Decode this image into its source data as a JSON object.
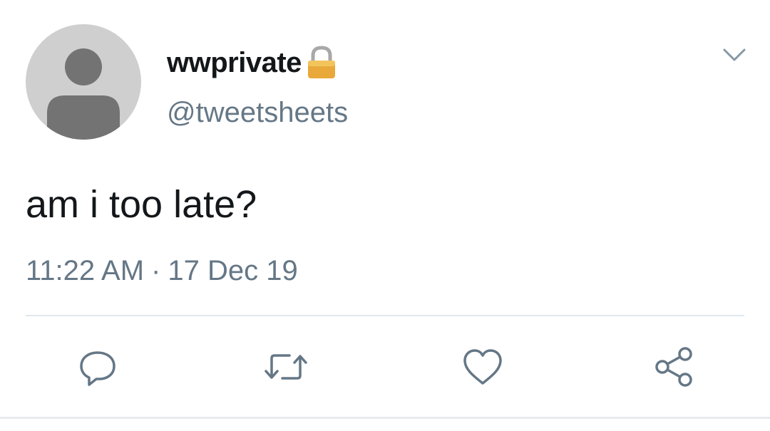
{
  "author": {
    "display_name": "wwprivate",
    "handle": "@tweetsheets",
    "avatar_icon": "default-profile-silhouette",
    "protected_icon": "lock-icon"
  },
  "tweet": {
    "text": "am i too late?",
    "time": "11:22 AM",
    "separator": "·",
    "date": "17 Dec 19"
  },
  "menu_icon": "chevron-down-icon",
  "actions": [
    {
      "name": "reply",
      "icon": "comment-icon"
    },
    {
      "name": "retweet",
      "icon": "retweet-icon"
    },
    {
      "name": "like",
      "icon": "heart-icon"
    },
    {
      "name": "share",
      "icon": "share-icon"
    }
  ],
  "colors": {
    "text": "#14171a",
    "secondary": "#657786",
    "divider": "#e1e8ed",
    "avatar_bg": "#cfcfcf",
    "avatar_fg": "#737373",
    "lock_gold": "#e8a93a"
  }
}
